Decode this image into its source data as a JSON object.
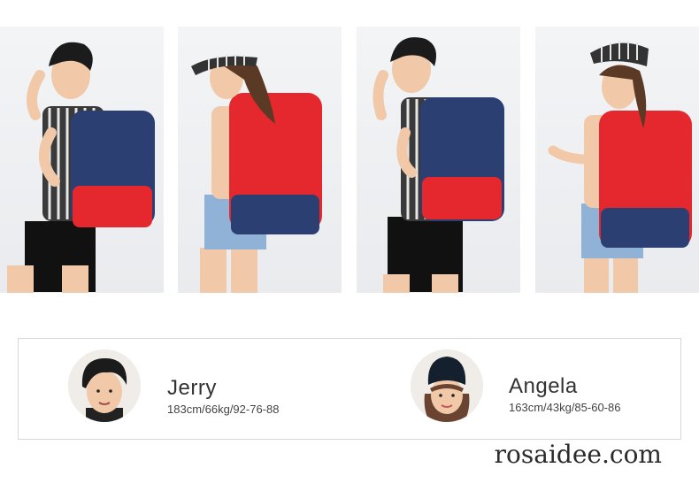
{
  "photos": [
    {
      "subject": "Jerry",
      "bag_color": "navy/red"
    },
    {
      "subject": "Angela",
      "bag_color": "red/navy"
    },
    {
      "subject": "Jerry",
      "bag_color": "navy/red"
    },
    {
      "subject": "Angela",
      "bag_color": "red/navy"
    }
  ],
  "colors": {
    "navy": "#2b3f73",
    "red": "#e4282e",
    "skin": "#f1c9a9",
    "hair": "#1b1b1b",
    "shorts": "#111111",
    "denim": "#8fb2d6"
  },
  "models": [
    {
      "name": "Jerry",
      "stats": "183cm/66kg/92-76-88"
    },
    {
      "name": "Angela",
      "stats": "163cm/43kg/85-60-86"
    }
  ],
  "watermark": "rosaidee.com"
}
